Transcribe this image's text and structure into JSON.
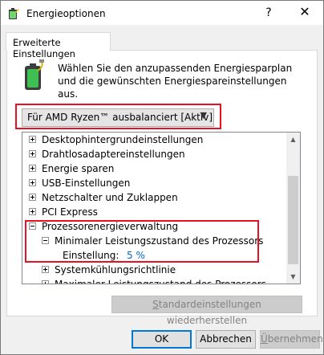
{
  "window": {
    "title": "Energieoptionen",
    "help_label": "?",
    "close_label": "✕"
  },
  "tab": {
    "label": "Erweiterte Einstellungen"
  },
  "description": "Wählen Sie den anzupassenden Energiesparplan und die gewünschten Energiespareinstellungen aus.",
  "plan_select": {
    "value": "Für AMD Ryzen™ ausbalanciert [Aktiv]"
  },
  "tree": {
    "items": [
      {
        "label": "Desktophintergrundeinstellungen"
      },
      {
        "label": "Drahtlosadaptereinstellungen"
      },
      {
        "label": "Energie sparen"
      },
      {
        "label": "USB-Einstellungen"
      },
      {
        "label": "Netzschalter und Zuklappen"
      },
      {
        "label": "PCI Express"
      },
      {
        "label": "Prozessorenergieverwaltung"
      },
      {
        "label": "Minimaler Leistungszustand des Prozessors"
      },
      {
        "label": "Einstellung:",
        "value": "5 %"
      },
      {
        "label": "Systemkühlungsrichtlinie"
      },
      {
        "label": "Maximaler Leistungszustand des Prozessors"
      }
    ]
  },
  "buttons": {
    "restore_pre": "S",
    "restore_rest": "tandardeinstellungen wiederherstellen",
    "ok": "OK",
    "cancel": "Abbrechen",
    "apply_pre": "Ü",
    "apply_rest": "bernehmen"
  },
  "colors": {
    "highlight": "#e81123",
    "value_link": "#0066cc",
    "battery": "#2fa84f"
  }
}
